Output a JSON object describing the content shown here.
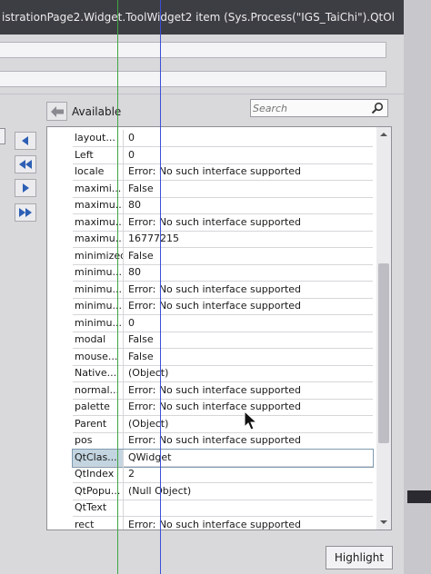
{
  "window": {
    "title": "istrationPage2.Widget.ToolWidget2 item (Sys.Process(\"IGS_TaiChi\").QtOl"
  },
  "available_label": "Available",
  "search": {
    "placeholder": "Search"
  },
  "icons": {
    "back": "back-arrow-icon",
    "search": "magnifier-icon",
    "move_left": "arrow-left-icon",
    "move_all_left": "double-arrow-left-icon",
    "move_right": "arrow-right-icon",
    "move_all_right": "double-arrow-right-icon"
  },
  "properties": [
    {
      "name": "layout...",
      "value": "0"
    },
    {
      "name": "Left",
      "value": "0"
    },
    {
      "name": "locale",
      "value": "Error: No such interface supported"
    },
    {
      "name": "maximi...",
      "value": "False"
    },
    {
      "name": "maximu...",
      "value": "80"
    },
    {
      "name": "maximu...",
      "value": "Error: No such interface supported"
    },
    {
      "name": "maximu...",
      "value": "16777215"
    },
    {
      "name": "minimized",
      "value": "False"
    },
    {
      "name": "minimu...",
      "value": "80"
    },
    {
      "name": "minimu...",
      "value": "Error: No such interface supported"
    },
    {
      "name": "minimu...",
      "value": "Error: No such interface supported"
    },
    {
      "name": "minimu...",
      "value": "0"
    },
    {
      "name": "modal",
      "value": "False"
    },
    {
      "name": "mouse...",
      "value": "False"
    },
    {
      "name": "Native...",
      "value": "(Object)"
    },
    {
      "name": "normal...",
      "value": "Error: No such interface supported"
    },
    {
      "name": "palette",
      "value": "Error: No such interface supported"
    },
    {
      "name": "Parent",
      "value": "(Object)"
    },
    {
      "name": "pos",
      "value": "Error: No such interface supported"
    },
    {
      "name": "QtClas...",
      "value": "QWidget",
      "selected": true
    },
    {
      "name": "QtIndex",
      "value": "2"
    },
    {
      "name": "QtPopu...",
      "value": "(Null Object)"
    },
    {
      "name": "QtText",
      "value": ""
    },
    {
      "name": "rect",
      "value": "Error: No such interface supported"
    }
  ],
  "buttons": {
    "highlight": "Highlight"
  },
  "colors": {
    "titlebar": "#3d3d44",
    "selection": "#c3d5e0",
    "guide_green": "#3fa544",
    "guide_blue": "#3a4fd8"
  }
}
